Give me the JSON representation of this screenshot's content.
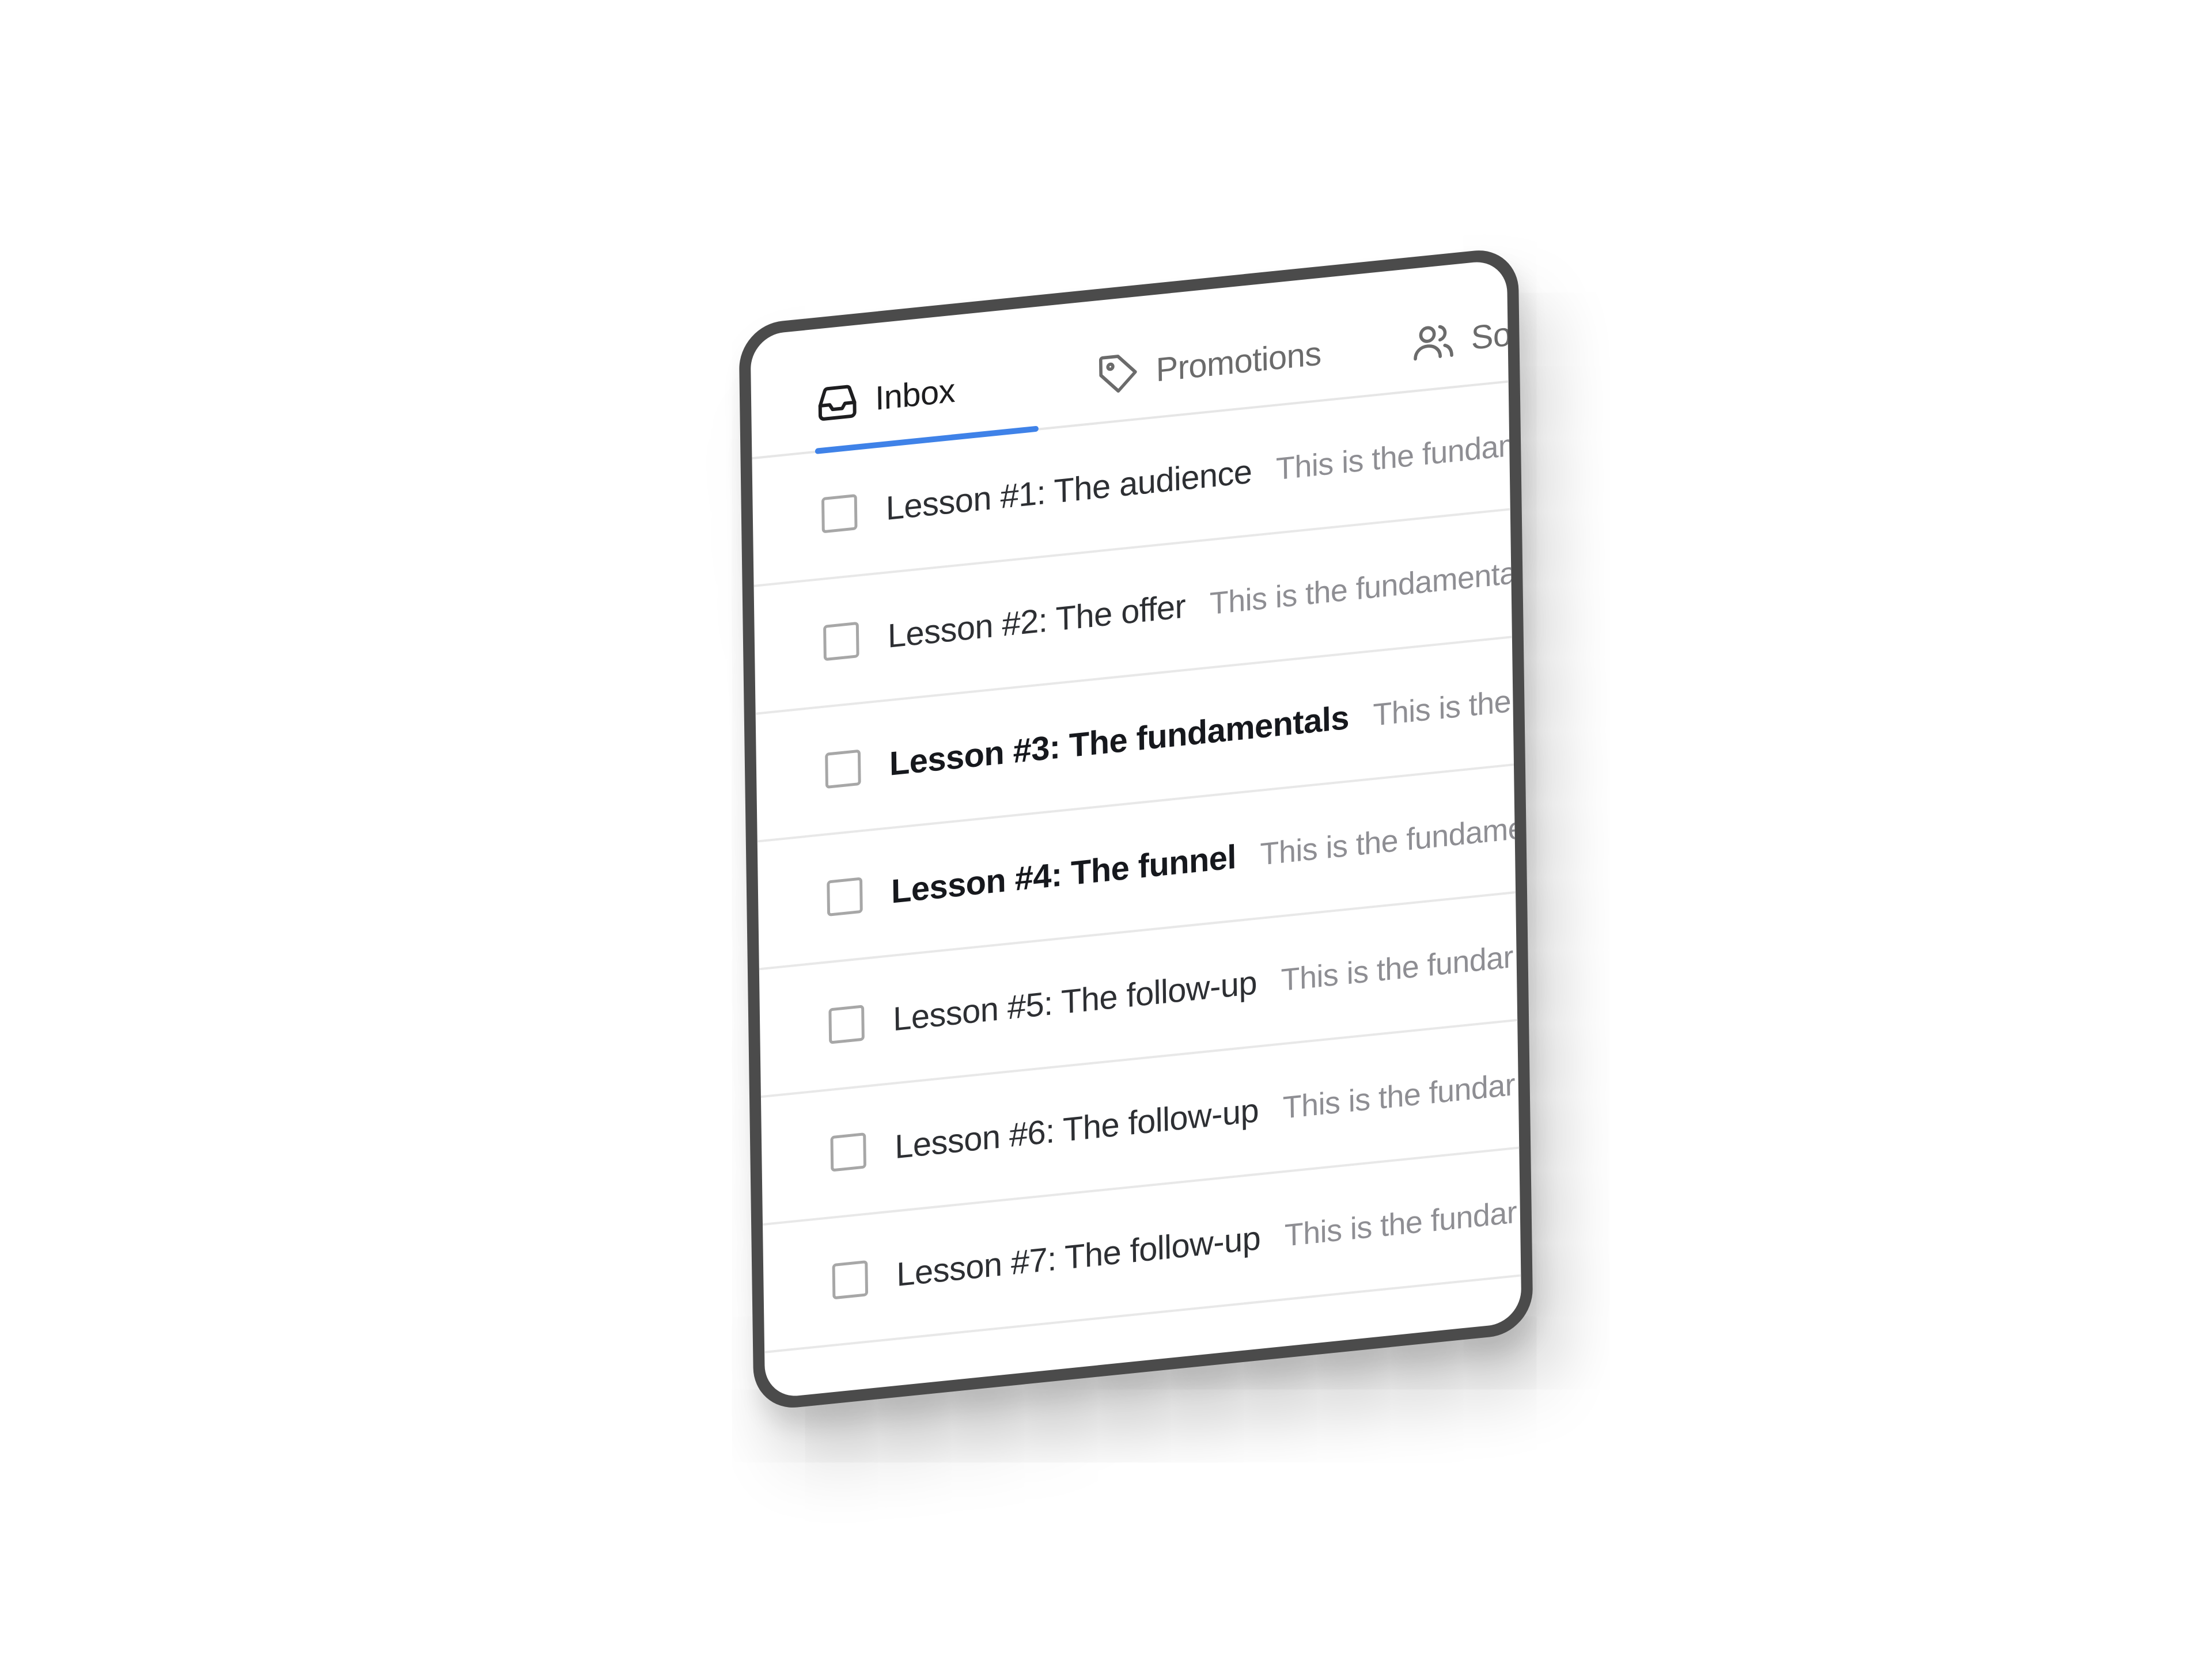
{
  "tabs": [
    {
      "label": "Inbox",
      "icon": "inbox-icon",
      "active": true
    },
    {
      "label": "Promotions",
      "icon": "tag-icon",
      "active": false
    },
    {
      "label": "Soci",
      "icon": "users-icon",
      "active": false
    }
  ],
  "accent_color": "#3f82e8",
  "messages": [
    {
      "subject": "Lesson #1: The audience",
      "preview": "This is the fundam",
      "unread": false
    },
    {
      "subject": "Lesson #2: The offer",
      "preview": "This is the fundamenta",
      "unread": false
    },
    {
      "subject": "Lesson #3: The fundamentals",
      "preview": "This is the fu",
      "unread": true
    },
    {
      "subject": "Lesson #4: The funnel",
      "preview": "This is the fundamen",
      "unread": true
    },
    {
      "subject": "Lesson #5: The follow-up",
      "preview": "This is the fundar",
      "unread": false
    },
    {
      "subject": "Lesson #6: The follow-up",
      "preview": "This is the fundar",
      "unread": false
    },
    {
      "subject": "Lesson #7: The follow-up",
      "preview": "This is the fundar",
      "unread": false
    }
  ]
}
